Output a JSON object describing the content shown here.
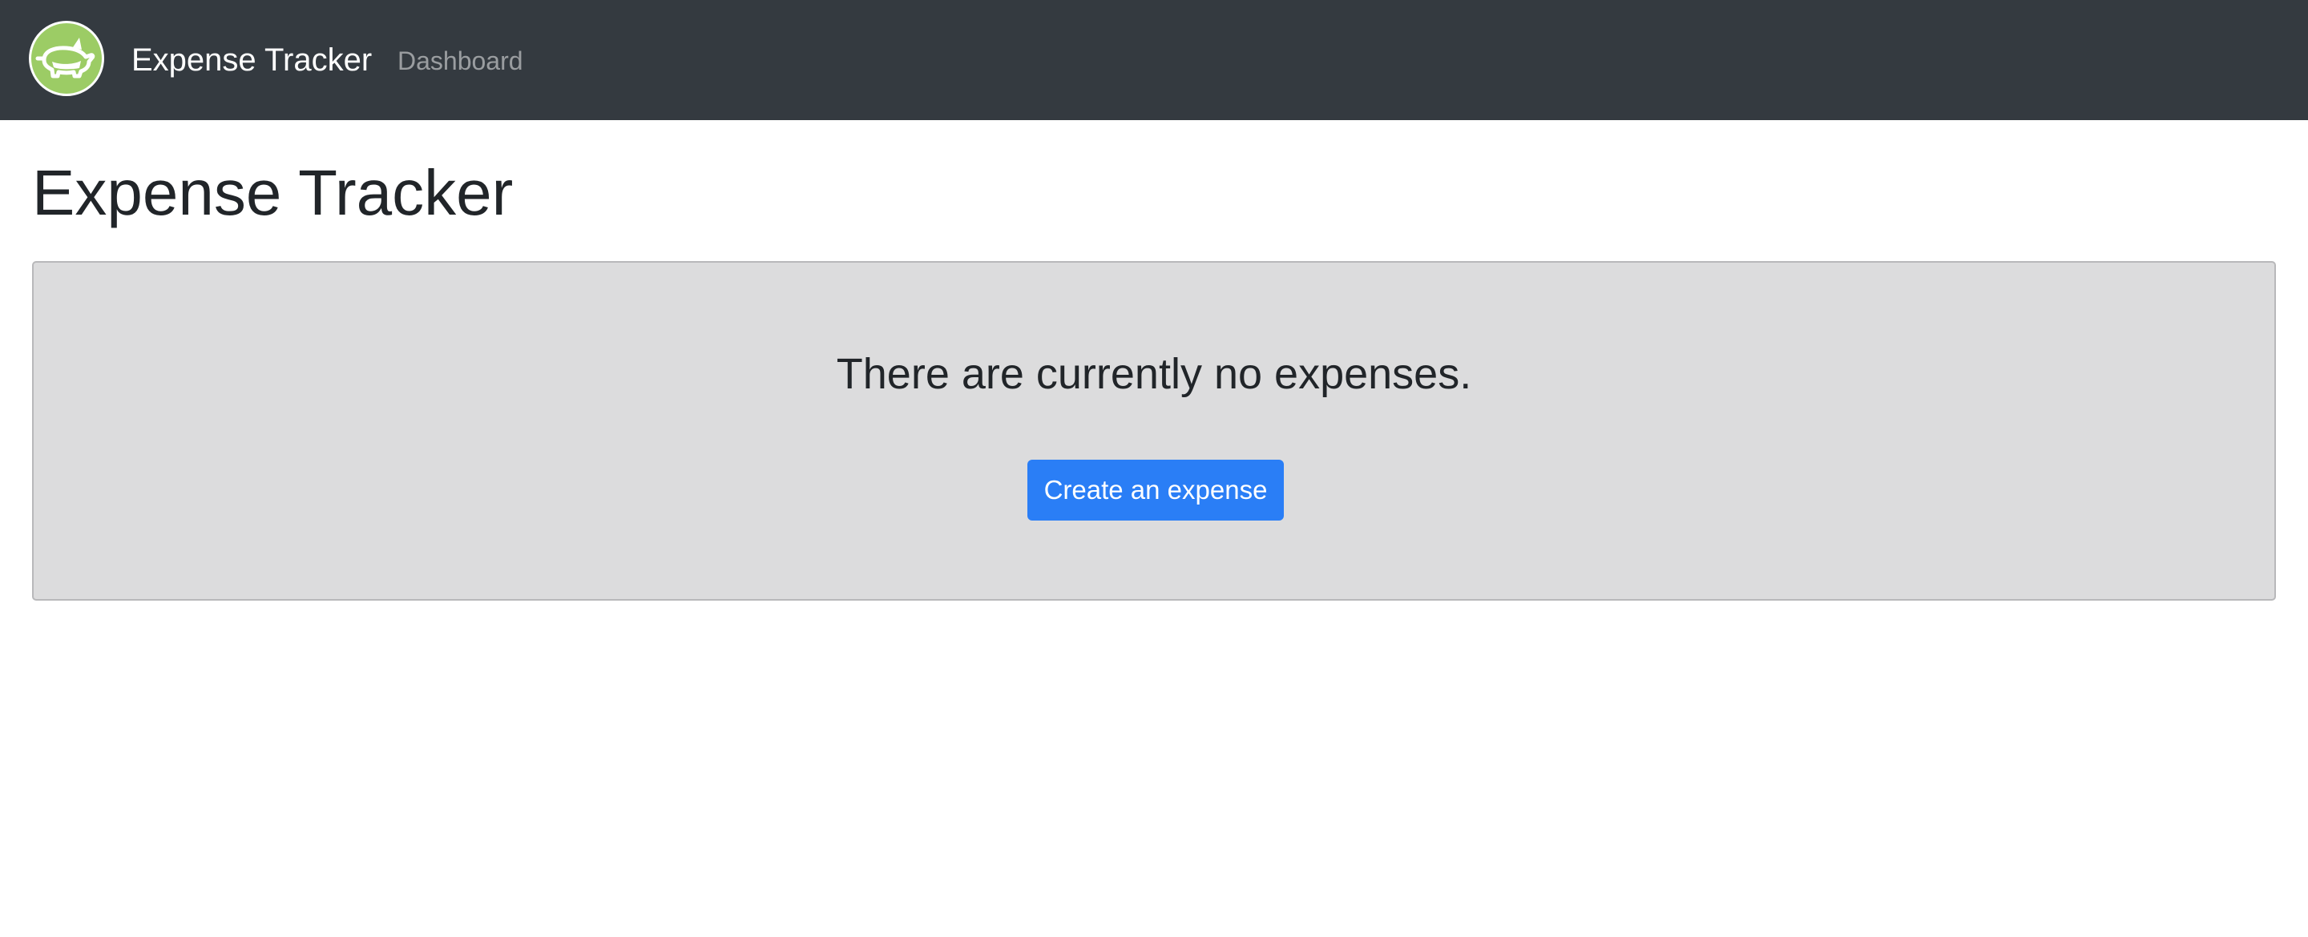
{
  "navbar": {
    "logo_icon": "piggy-bank-icon",
    "brand": "Expense Tracker",
    "links": [
      {
        "label": "Dashboard"
      }
    ],
    "background_color": "#343a40",
    "logo_color": "#9ccc65"
  },
  "main": {
    "title": "Expense Tracker",
    "empty_state": {
      "message": "There are currently no expenses.",
      "button_label": "Create an expense",
      "button_color": "#2a7ef6",
      "panel_color": "#dcdcdd"
    }
  }
}
